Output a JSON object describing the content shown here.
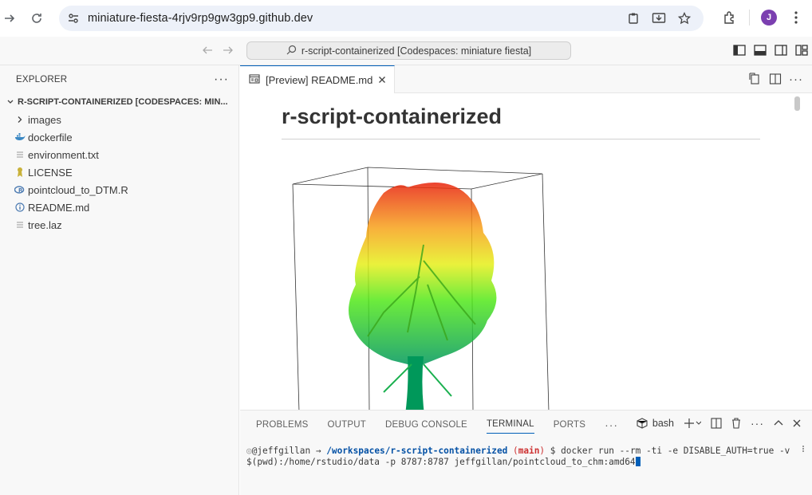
{
  "browser": {
    "url": "miniature-fiesta-4rjv9rp9gw3gp9.github.dev",
    "avatar_letter": "J",
    "avatar_color": "#7b3fb0"
  },
  "titlebar": {
    "command_center": "r-script-containerized [Codespaces: miniature fiesta]"
  },
  "sidebar": {
    "title": "EXPLORER",
    "folder": "R-SCRIPT-CONTAINERIZED [CODESPACES: MIN...",
    "items": [
      {
        "label": "images",
        "icon": "chevron-right-icon"
      },
      {
        "label": "dockerfile",
        "icon": "docker-icon"
      },
      {
        "label": "environment.txt",
        "icon": "lines-icon"
      },
      {
        "label": "LICENSE",
        "icon": "license-icon"
      },
      {
        "label": "pointcloud_to_DTM.R",
        "icon": "r-file-icon"
      },
      {
        "label": "README.md",
        "icon": "info-icon"
      },
      {
        "label": "tree.laz",
        "icon": "lines-icon"
      }
    ]
  },
  "editor": {
    "tab_label": "[Preview] README.md",
    "heading": "r-script-containerized"
  },
  "panel": {
    "tabs": [
      "PROBLEMS",
      "OUTPUT",
      "DEBUG CONSOLE",
      "TERMINAL",
      "PORTS"
    ],
    "active_tab": "TERMINAL",
    "shell": "bash",
    "terminal": {
      "user": "@jeffgillan",
      "arrow": " → ",
      "path": "/workspaces/r-script-containerized",
      "branch": "main",
      "command": " $ docker run --rm -ti -e DISABLE_AUTH=true -v $(pwd):/home/rstudio/data -p 8787:8787 jeffgillan/pointcloud_to_chm:amd64"
    }
  },
  "colors": {
    "accent": "#005fb8"
  }
}
